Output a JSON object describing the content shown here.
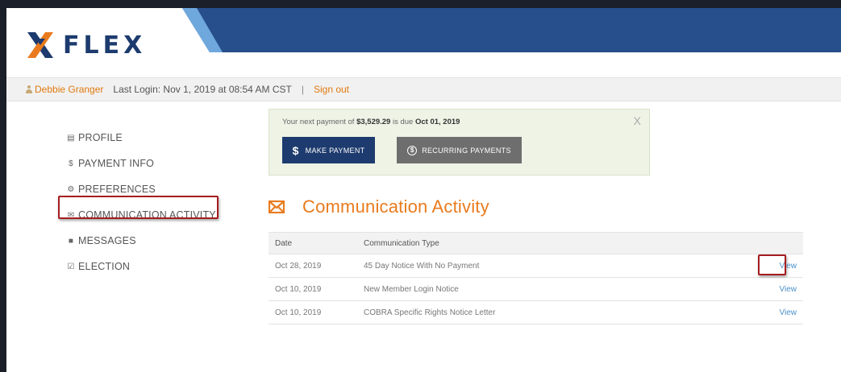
{
  "header": {
    "logo_text": "FLEX",
    "brand_colors": {
      "navy": "#1d3b6e",
      "orange": "#e97b1e",
      "accent_light_blue": "#6fa8dc"
    }
  },
  "userbar": {
    "user_name": "Debbie Granger",
    "last_login": "Last Login: Nov 1, 2019 at 08:54 AM CST",
    "separator": "|",
    "sign_out": "Sign out"
  },
  "sidebar": {
    "items": [
      {
        "label": "PROFILE",
        "icon": "profile-card-icon",
        "glyph": "▤"
      },
      {
        "label": "PAYMENT INFO",
        "icon": "dollar-icon",
        "glyph": "$"
      },
      {
        "label": "PREFERENCES",
        "icon": "sliders-icon",
        "glyph": "⚙"
      },
      {
        "label": "COMMUNICATION ACTIVITY",
        "icon": "envelope-icon",
        "glyph": "✉"
      },
      {
        "label": "MESSAGES",
        "icon": "chat-bubble-icon",
        "glyph": "■"
      },
      {
        "label": "ELECTION",
        "icon": "checkbox-icon",
        "glyph": "☑"
      }
    ]
  },
  "notice": {
    "prefix": "Your next payment of ",
    "amount": "$3,529.29",
    "middle": " is due ",
    "due_date": "Oct 01, 2019",
    "close": "X",
    "make_payment": "MAKE PAYMENT",
    "make_payment_icon": "$",
    "recurring_payments": "RECURRING PAYMENTS",
    "recurring_icon": "$"
  },
  "main": {
    "title": "Communication Activity",
    "table": {
      "headers": {
        "date": "Date",
        "type": "Communication Type"
      },
      "rows": [
        {
          "date": "Oct 28, 2019",
          "type": "45 Day Notice With No Payment",
          "action": "View"
        },
        {
          "date": "Oct 10, 2019",
          "type": "New Member Login Notice",
          "action": "View"
        },
        {
          "date": "Oct 10, 2019",
          "type": "COBRA Specific Rights Notice Letter",
          "action": "View"
        }
      ]
    }
  }
}
